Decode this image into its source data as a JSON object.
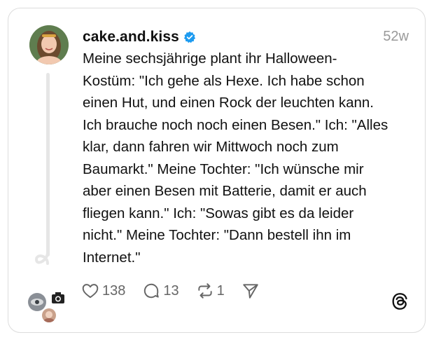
{
  "post": {
    "username": "cake.and.kiss",
    "timestamp": "52w",
    "text": "Meine sechsjährige plant ihr Halloween-\nKostüm: \"Ich gehe als Hexe. Ich habe schon\neinen Hut, und einen Rock der leuchten kann.\nIch brauche noch noch einen Besen.\" Ich: \"Alles\nklar, dann fahren wir Mittwoch noch zum\nBaumarkt.\" Meine Tochter: \"Ich wünsche mir\naber einen Besen mit Batterie, damit er auch\nfliegen kann.\" Ich: \"Sowas gibt es da leider\nnicht.\" Meine Tochter: \"Dann bestell ihn im\nInternet.\"",
    "likes": "138",
    "replies": "13",
    "reposts": "1"
  },
  "icons": {
    "verified": "verified-badge-icon",
    "like": "heart-icon",
    "reply": "comment-icon",
    "repost": "repost-icon",
    "share": "send-icon",
    "brand": "threads-logo-icon"
  },
  "colors": {
    "verified": "#1d9bf0",
    "muted": "#999999",
    "text": "#111111"
  }
}
